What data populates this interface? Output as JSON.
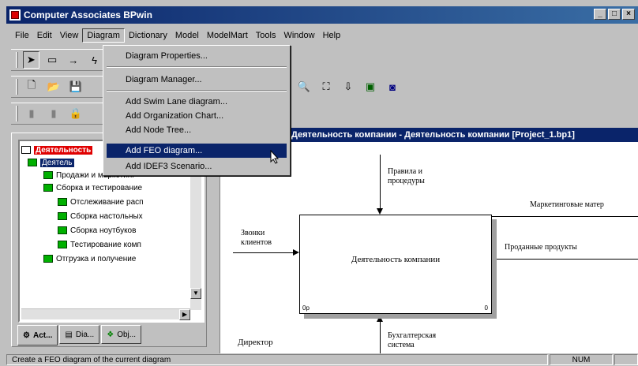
{
  "window": {
    "title": "Computer Associates BPwin"
  },
  "menubar": [
    "File",
    "Edit",
    "View",
    "Diagram",
    "Dictionary",
    "Model",
    "ModelMart",
    "Tools",
    "Window",
    "Help"
  ],
  "diagram_menu": {
    "items": [
      "Diagram Properties...",
      "Diagram Manager...",
      "Add Swim Lane diagram...",
      "Add Organization Chart...",
      "Add Node Tree...",
      "Add FEO diagram...",
      "Add IDEF3 Scenario..."
    ],
    "highlighted": "Add FEO diagram..."
  },
  "tree": {
    "root": "Деятельность",
    "selected": "Деятель",
    "items": [
      "Продажи и маркетинг",
      "Сборка и тестирование",
      "Отслеживание расп",
      "Сборка настольных",
      "Сборка ноутбуков",
      "Тестирование комп",
      "Отгрузка и получение"
    ]
  },
  "tabs": [
    "Act...",
    "Dia...",
    "Obj..."
  ],
  "diagram": {
    "title": "Деятельность компании - Деятельность компании  [Project_1.bp1]",
    "activity": "Деятельность компании",
    "corner_left": "0p",
    "corner_right": "0",
    "labels": {
      "control": "Правила и процедуры",
      "input": "Звонки клиентов",
      "output_top": "Маркетинговые матер",
      "output": "Проданные продукты",
      "mechanism": "Бухгалтерская система",
      "director": "Директор"
    }
  },
  "status": {
    "text": "Create a FEO diagram of the current diagram",
    "num": "NUM"
  }
}
